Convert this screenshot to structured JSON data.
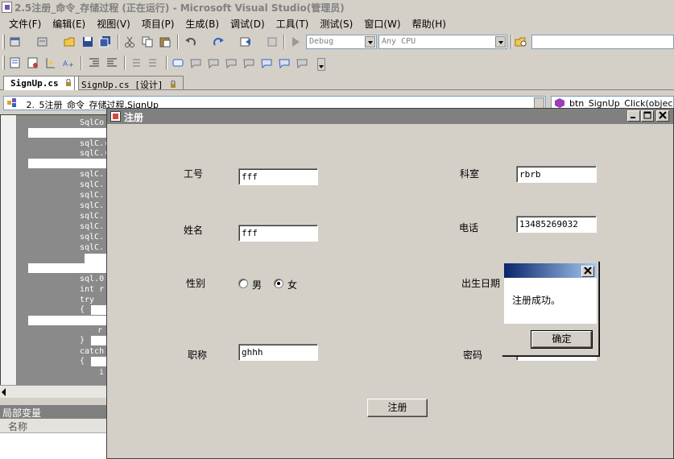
{
  "vs": {
    "title": "2.5注册_命令_存储过程 (正在运行) - Microsoft Visual Studio(管理员)",
    "menu": [
      "文件(F)",
      "编辑(E)",
      "视图(V)",
      "项目(P)",
      "生成(B)",
      "调试(D)",
      "工具(T)",
      "测试(S)",
      "窗口(W)",
      "帮助(H)"
    ],
    "config_combo": "Debug",
    "platform_combo": "Any CPU",
    "tabs": [
      {
        "label": "SignUp.cs"
      },
      {
        "label": "SignUp.cs [设计]"
      }
    ],
    "nav_left": "_2._5注册_命令_存储过程.SignUp",
    "nav_right": "btn_SignUp_Click(objec",
    "code_lines": [
      "SqlCo",
      "sqlC.(",
      "sqlC.(",
      "sqlC.",
      "sqlC.",
      "sqlC.",
      "sqlC.",
      "sqlC.",
      "sqlC.",
      "sqlC.",
      "sqlC.",
      "sql.0",
      "int r",
      "try",
      "{",
      "r",
      "}",
      "catch",
      "{",
      "i"
    ],
    "locals_title": "局部变量",
    "locals_col": "名称"
  },
  "form": {
    "title": "注册",
    "fields": {
      "emp_id": {
        "label": "工号",
        "value": "fff"
      },
      "name": {
        "label": "姓名",
        "value": "fff"
      },
      "gender": {
        "label": "性别",
        "male": "男",
        "female": "女",
        "selected": "女"
      },
      "title": {
        "label": "职称",
        "value": "ghhh"
      },
      "dept": {
        "label": "科室",
        "value": "rbrb"
      },
      "phone": {
        "label": "电话",
        "value": "13485269032"
      },
      "birth": {
        "label": "出生日期"
      },
      "password": {
        "label": "密码"
      }
    },
    "submit_label": "注册"
  },
  "msgbox": {
    "message": "注册成功。",
    "ok_label": "确定"
  }
}
